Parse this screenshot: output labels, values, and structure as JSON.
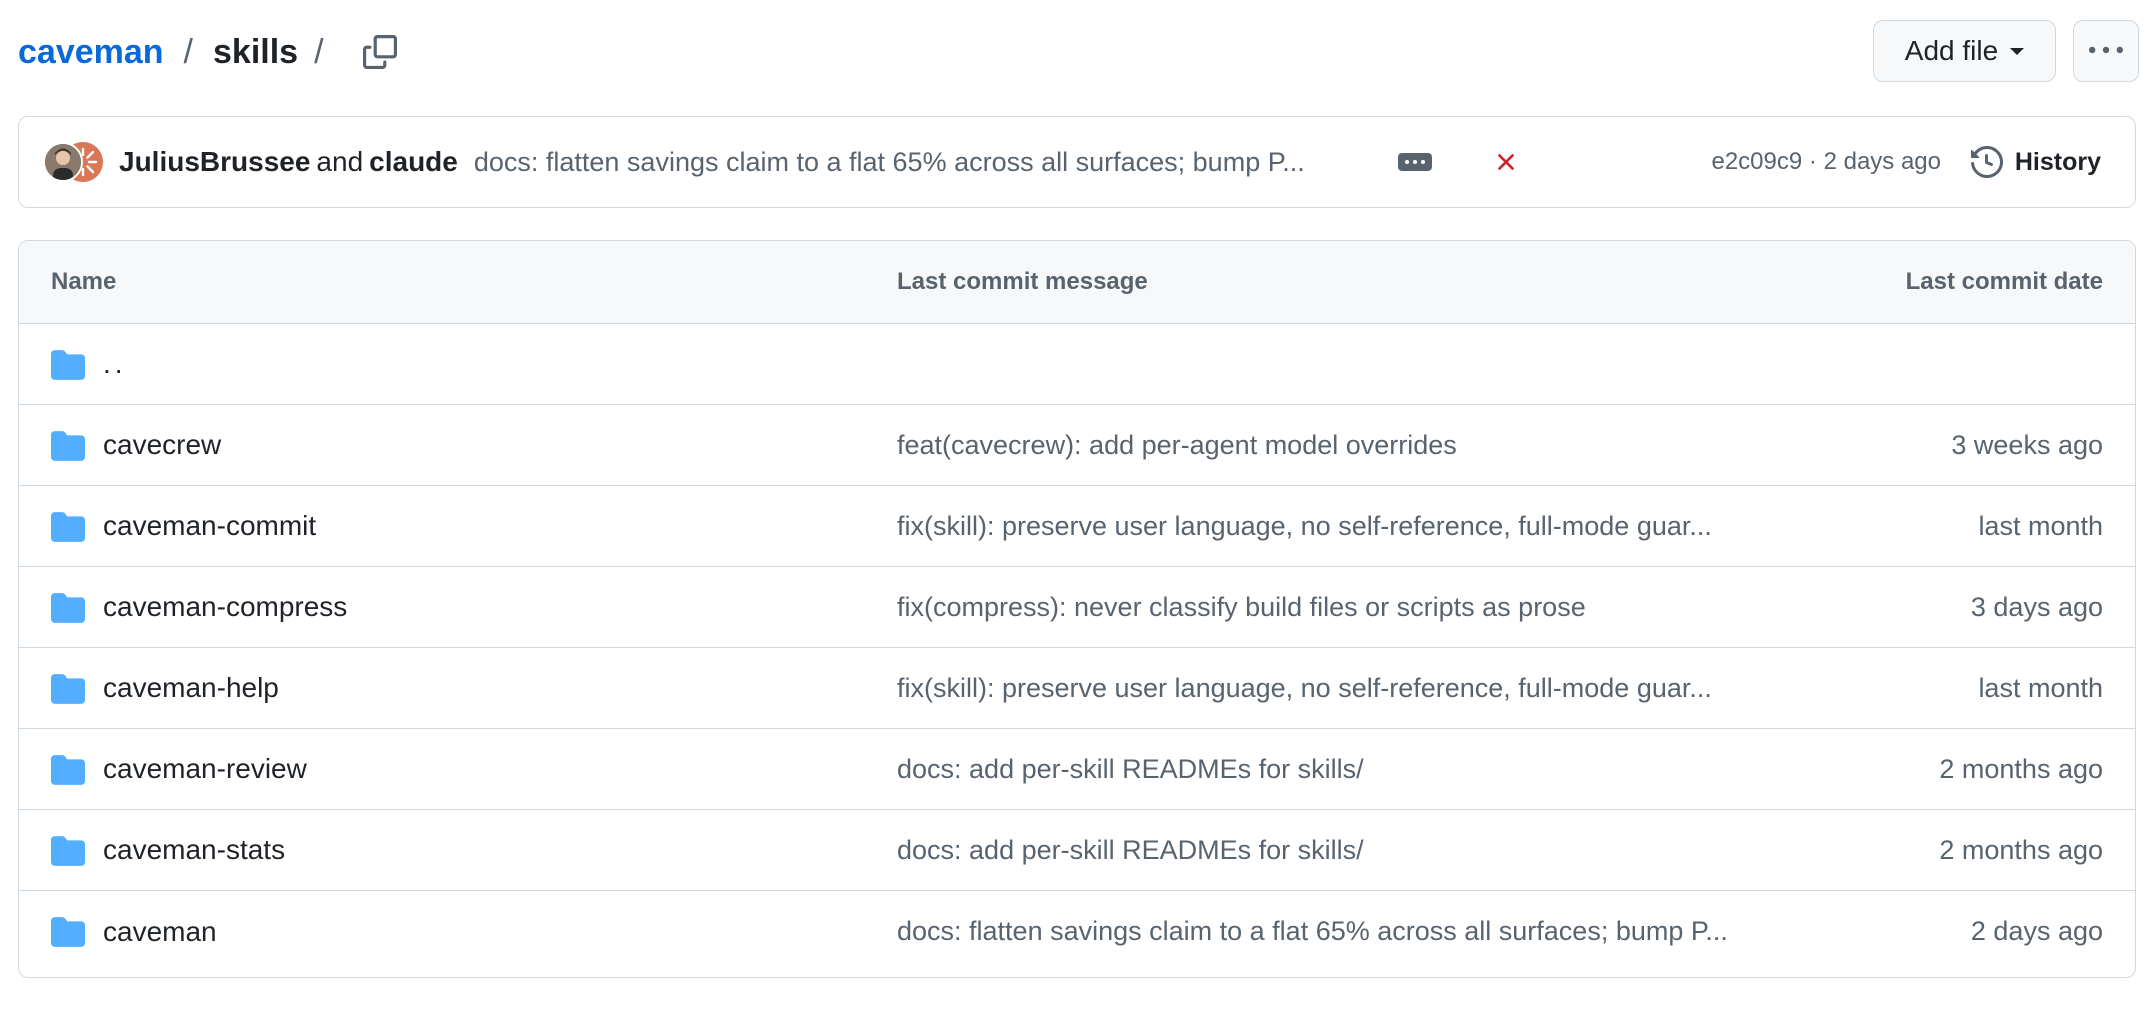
{
  "breadcrumb": {
    "repo": "caveman",
    "separator": "/",
    "directory": "skills",
    "trailing_separator": "/"
  },
  "toolbar": {
    "add_file_label": "Add file",
    "add_file_icon": "triangle-down-icon",
    "more_icon": "kebab-horizontal-icon",
    "copy_icon": "copy-icon"
  },
  "commit": {
    "author1": "JuliusBrussee",
    "and_text": "and",
    "author2": "claude",
    "message": "docs: flatten savings claim to a flat 65% across all surfaces; bump P...",
    "status": "failure",
    "status_color": "#cf222e",
    "hash": "e2c09c9",
    "dot": "·",
    "time": "2 days ago",
    "history_label": "History",
    "history_icon": "history-icon"
  },
  "table": {
    "headers": {
      "name": "Name",
      "message": "Last commit message",
      "date": "Last commit date"
    },
    "parent_link": "..",
    "rows": [
      {
        "name": "cavecrew",
        "message": "feat(cavecrew): add per-agent model overrides",
        "date": "3 weeks ago"
      },
      {
        "name": "caveman-commit",
        "message": "fix(skill): preserve user language, no self-reference, full-mode guar...",
        "date": "last month"
      },
      {
        "name": "caveman-compress",
        "message": "fix(compress): never classify build files or scripts as prose",
        "date": "3 days ago"
      },
      {
        "name": "caveman-help",
        "message": "fix(skill): preserve user language, no self-reference, full-mode guar...",
        "date": "last month"
      },
      {
        "name": "caveman-review",
        "message": "docs: add per-skill READMEs for skills/",
        "date": "2 months ago"
      },
      {
        "name": "caveman-stats",
        "message": "docs: add per-skill READMEs for skills/",
        "date": "2 months ago"
      },
      {
        "name": "caveman",
        "message": "docs: flatten savings claim to a flat 65% across all surfaces; bump P...",
        "date": "2 days ago"
      }
    ]
  },
  "colors": {
    "link": "#0969da",
    "folder": "#54aeff",
    "muted": "#59636e",
    "border": "#d1d9e0"
  }
}
